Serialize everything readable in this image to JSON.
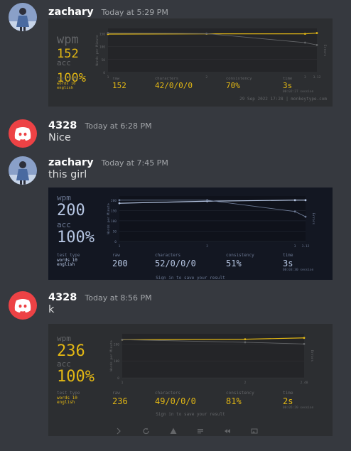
{
  "messages": [
    {
      "username": "zachary",
      "timestamp": "Today at 5:29 PM",
      "card": {
        "theme": {
          "bg": "#2c2e31",
          "main": "#e2b714",
          "sub": "#646669",
          "text": "#d1d0c5"
        },
        "wpm_label": "wpm",
        "wpm": "152",
        "acc_label": "acc",
        "acc": "100%",
        "test_type_label": "test type",
        "test_type": "words 10",
        "language": "english",
        "raw_label": "raw",
        "raw": "152",
        "characters_label": "characters",
        "characters": "42/0/0/0",
        "consistency_label": "consistency",
        "consistency": "70%",
        "time_label": "time",
        "time": "3s",
        "session": "00:02:27 session",
        "footer": "29 Sep 2022 17:28 | monkeytype.com",
        "y_axis_label": "Words per Minute",
        "right_axis_label": "Errors",
        "y_ticks": [
          "150",
          "100",
          "50",
          "0"
        ],
        "x_ticks": [
          "1",
          "2",
          "3",
          "3.12"
        ]
      },
      "chart_data": {
        "type": "line",
        "x": [
          1,
          2,
          3,
          3.12
        ],
        "series": [
          {
            "name": "wpm",
            "values": [
              148,
              149,
              149,
              152
            ]
          },
          {
            "name": "raw",
            "values": [
              152,
              150,
              115,
              106
            ]
          }
        ],
        "ylim": [
          0,
          170
        ]
      }
    },
    {
      "username": "4328",
      "timestamp": "Today at 6:28 PM",
      "text": "Nice"
    },
    {
      "username": "zachary",
      "timestamp": "Today at 7:45 PM",
      "text": "this girl",
      "card": {
        "theme": {
          "bg": "#131722",
          "main": "#b6c6e3",
          "sub": "#6b7893",
          "text": "#b6c6e3"
        },
        "wpm_label": "wpm",
        "wpm": "200",
        "acc_label": "acc",
        "acc": "100%",
        "test_type_label": "test type",
        "test_type": "words 10",
        "language": "english",
        "raw_label": "raw",
        "raw": "200",
        "characters_label": "characters",
        "characters": "52/0/0/0",
        "consistency_label": "consistency",
        "consistency": "51%",
        "time_label": "time",
        "time": "3s",
        "session": "00:03:30 session",
        "footer": "Sign in to save your result",
        "y_axis_label": "Words per Minute",
        "right_axis_label": "Errors",
        "y_ticks": [
          "200",
          "150",
          "100",
          "50",
          "0"
        ],
        "x_ticks": [
          "1",
          "2",
          "3",
          "3.12"
        ]
      },
      "chart_data": {
        "type": "line",
        "x": [
          1,
          2,
          3,
          3.12
        ],
        "series": [
          {
            "name": "wpm",
            "values": [
              185,
              195,
              200,
              200
            ]
          },
          {
            "name": "raw",
            "values": [
              200,
              200,
              145,
              120
            ]
          }
        ],
        "ylim": [
          0,
          220
        ]
      }
    },
    {
      "username": "4328",
      "timestamp": "Today at 8:56 PM",
      "text": "k",
      "card": {
        "theme": {
          "bg": "#2c2e31",
          "main": "#e2b714",
          "sub": "#646669",
          "text": "#d1d0c5"
        },
        "wpm_label": "wpm",
        "wpm": "236",
        "acc_label": "acc",
        "acc": "100%",
        "test_type_label": "test type",
        "test_type": "words 10",
        "language": "english",
        "raw_label": "raw",
        "raw": "236",
        "characters_label": "characters",
        "characters": "49/0/0/0",
        "consistency_label": "consistency",
        "consistency": "81%",
        "time_label": "time",
        "time": "2s",
        "session": "00:05:20 session",
        "footer": "Sign in to save your result",
        "y_axis_label": "Words per Minute",
        "right_axis_label": "Errors",
        "y_ticks": [
          "200",
          "100",
          "0"
        ],
        "x_ticks": [
          "1",
          "2",
          "2.48"
        ]
      },
      "chart_data": {
        "type": "line",
        "x": [
          1,
          2,
          2.48
        ],
        "series": [
          {
            "name": "wpm",
            "values": [
              225,
              228,
              236
            ]
          },
          {
            "name": "raw",
            "values": [
              225,
              210,
              200
            ]
          }
        ],
        "ylim": [
          0,
          260
        ]
      },
      "toolbar": [
        "next-icon",
        "restart-icon",
        "warning-icon",
        "list-icon",
        "replay-icon",
        "image-icon"
      ]
    }
  ]
}
